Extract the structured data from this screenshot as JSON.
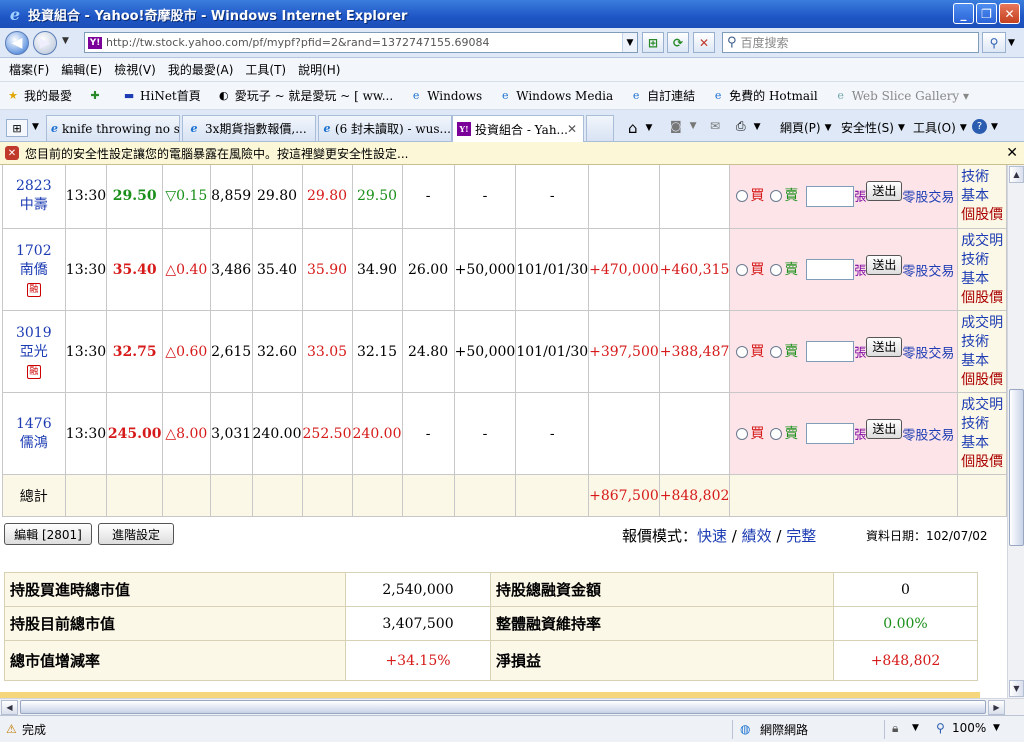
{
  "window": {
    "title": "投資組合 - Yahoo!奇摩股市 - Windows Internet Explorer"
  },
  "address": {
    "url": "http://tw.stock.yahoo.com/pf/mypf?pfid=2&rand=1372747155.69084",
    "search_placeholder": "百度搜索"
  },
  "menu": [
    "檔案(F)",
    "編輯(E)",
    "檢視(V)",
    "我的最愛(A)",
    "工具(T)",
    "說明(H)"
  ],
  "favorites": {
    "label": "我的最愛",
    "items": [
      "HiNet首頁",
      "愛玩子 ~ 就是愛玩 ~ [ ww...",
      "Windows",
      "Windows Media",
      "自訂連結",
      "免費的 Hotmail",
      "Web Slice Gallery ▾"
    ]
  },
  "tabs": [
    "knife throwing no sp...",
    "3x期貨指數報價,...",
    "(6 封未讀取) - wus...",
    "投資組合 - Yah..."
  ],
  "toolbar": {
    "page": "網頁(P)",
    "safety": "安全性(S)",
    "tools": "工具(O)"
  },
  "infobar": "您目前的安全性設定讓您的電腦暴露在風險中。按這裡變更安全性設定...",
  "trade_labels": {
    "buy": "買",
    "sell": "賣",
    "unit": "張",
    "submit": "送出",
    "odd_lot": "零股交易"
  },
  "link_labels": {
    "deal": "成交明",
    "tech": "技術",
    "basic": "基本",
    "personal": "個股價"
  },
  "stocks": [
    {
      "code": "2823",
      "name": "中壽",
      "badge": "",
      "time": "13:30",
      "price": "29.50",
      "dir": "dn",
      "change": "▽0.15",
      "volume": "8,859",
      "open": "29.80",
      "high": "29.80",
      "low": "29.50",
      "cost": "-",
      "shares": "-",
      "date": "-",
      "pl1": "",
      "pl2": ""
    },
    {
      "code": "1702",
      "name": "南僑",
      "badge": "融",
      "time": "13:30",
      "price": "35.40",
      "dir": "up",
      "change": "△0.40",
      "volume": "3,486",
      "open": "35.40",
      "high": "35.90",
      "low": "34.90",
      "cost": "26.00",
      "shares": "+50,000",
      "date": "101/01/30",
      "pl1": "+470,000",
      "pl2": "+460,315"
    },
    {
      "code": "3019",
      "name": "亞光",
      "badge": "融",
      "time": "13:30",
      "price": "32.75",
      "dir": "up",
      "change": "△0.60",
      "volume": "2,615",
      "open": "32.60",
      "high": "33.05",
      "low": "32.15",
      "cost": "24.80",
      "shares": "+50,000",
      "date": "101/01/30",
      "pl1": "+397,500",
      "pl2": "+388,487"
    },
    {
      "code": "1476",
      "name": "儒鴻",
      "badge": "",
      "time": "13:30",
      "price": "245.00",
      "dir": "up",
      "change": "△8.00",
      "volume": "3,031",
      "open": "240.00",
      "high": "252.50",
      "low": "240.00",
      "cost": "-",
      "shares": "-",
      "date": "-",
      "pl1": "",
      "pl2": ""
    }
  ],
  "total": {
    "label": "總計",
    "pl1": "+867,500",
    "pl2": "+848,802"
  },
  "buttons": {
    "edit": "編輯 [2801]",
    "advanced": "進階設定"
  },
  "mode": {
    "label": "報價模式：",
    "fast": "快速",
    "sep": " / ",
    "perf": "績效",
    "full": "完整"
  },
  "data_date": "資料日期：102/07/02",
  "summary": [
    {
      "l1": "持股買進時總市值",
      "v1": "2,540,000",
      "l2": "持股總融資金額",
      "v2": "0"
    },
    {
      "l1": "持股目前總市值",
      "v1": "3,407,500",
      "l2": "整體融資維持率",
      "v2": "0.00%"
    },
    {
      "l1": "總市值增減率",
      "v1": "+34.15%",
      "l2": "淨損益",
      "v2": "+848,802"
    }
  ],
  "status": {
    "text": "完成",
    "zone": "網際網路",
    "zoom": "100%"
  },
  "colors": {
    "up": "#d61a1a",
    "down": "#1a8f1a",
    "link": "#1d3cb3",
    "trade_bg": "#fce4e8",
    "summary_bg": "#fcf8e7"
  }
}
